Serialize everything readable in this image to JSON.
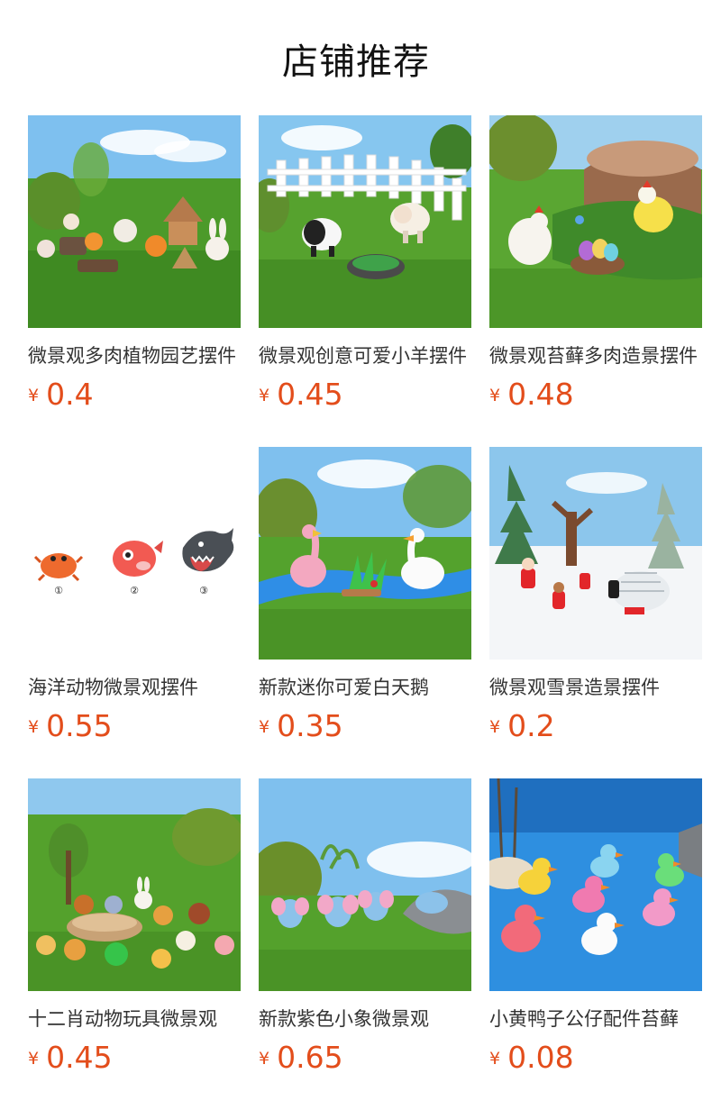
{
  "title": "店铺推荐",
  "currency": "¥",
  "products": [
    {
      "name": "微景观多肉植物园艺摆件",
      "price": "0.4",
      "image": "garden-animals-image"
    },
    {
      "name": "微景观创意可爱小羊摆件",
      "price": "0.45",
      "image": "sheep-fence-image"
    },
    {
      "name": "微景观苔藓多肉造景摆件",
      "price": "0.48",
      "image": "chicken-stump-image"
    },
    {
      "name": "海洋动物微景观摆件",
      "price": "0.55",
      "image": "sea-animals-image",
      "labels": [
        "①",
        "②",
        "③"
      ]
    },
    {
      "name": "新款迷你可爱白天鹅",
      "price": "0.35",
      "image": "swan-pond-image"
    },
    {
      "name": "微景观雪景造景摆件",
      "price": "0.2",
      "image": "snow-scene-image"
    },
    {
      "name": "十二肖动物玩具微景观",
      "price": "0.45",
      "image": "zodiac-animals-image"
    },
    {
      "name": "新款紫色小象微景观",
      "price": "0.65",
      "image": "elephants-image"
    },
    {
      "name": "小黄鸭子公仔配件苔藓",
      "price": "0.08",
      "image": "ducks-sand-image"
    }
  ]
}
